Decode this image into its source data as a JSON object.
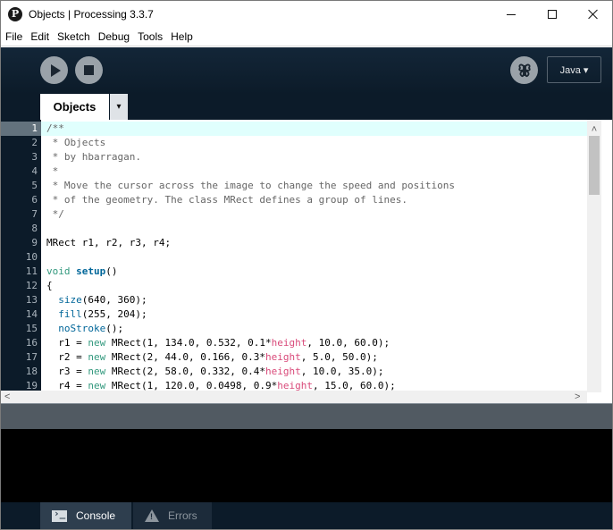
{
  "window": {
    "title": "Objects | Processing 3.3.7",
    "app_icon_letter": "P"
  },
  "menu": [
    "File",
    "Edit",
    "Sketch",
    "Debug",
    "Tools",
    "Help"
  ],
  "toolbar": {
    "run_icon": "play-icon",
    "stop_icon": "stop-icon",
    "debugger_icon": "butterfly-icon",
    "mode_label": "Java ▾"
  },
  "tabs": {
    "active": "Objects",
    "menu_glyph": "▾"
  },
  "editor": {
    "current_line": 1,
    "line_numbers": [
      "1",
      "2",
      "3",
      "4",
      "5",
      "6",
      "7",
      "8",
      "9",
      "10",
      "11",
      "12",
      "13",
      "14",
      "15",
      "16",
      "17",
      "18",
      "19"
    ],
    "lines": [
      [
        {
          "t": "/**",
          "c": "comment"
        }
      ],
      [
        {
          "t": " * Objects",
          "c": "comment"
        }
      ],
      [
        {
          "t": " * by hbarragan.",
          "c": "comment"
        }
      ],
      [
        {
          "t": " *",
          "c": "comment"
        }
      ],
      [
        {
          "t": " * Move the cursor across the image to change the speed and positions",
          "c": "comment"
        }
      ],
      [
        {
          "t": " * of the geometry. The class MRect defines a group of lines.",
          "c": "comment"
        }
      ],
      [
        {
          "t": " */",
          "c": "comment"
        }
      ],
      [],
      [
        {
          "t": "MRect r1, r2, r3, r4;",
          "c": ""
        }
      ],
      [],
      [
        {
          "t": "void",
          "c": "kw"
        },
        {
          "t": " ",
          "c": ""
        },
        {
          "t": "setup",
          "c": "fnb"
        },
        {
          "t": "()",
          "c": ""
        }
      ],
      [
        {
          "t": "{",
          "c": ""
        }
      ],
      [
        {
          "t": "  ",
          "c": ""
        },
        {
          "t": "size",
          "c": "fn"
        },
        {
          "t": "(640, 360);",
          "c": ""
        }
      ],
      [
        {
          "t": "  ",
          "c": ""
        },
        {
          "t": "fill",
          "c": "fn"
        },
        {
          "t": "(255, 204);",
          "c": ""
        }
      ],
      [
        {
          "t": "  ",
          "c": ""
        },
        {
          "t": "noStroke",
          "c": "fn"
        },
        {
          "t": "();",
          "c": ""
        }
      ],
      [
        {
          "t": "  r1 = ",
          "c": ""
        },
        {
          "t": "new",
          "c": "kw"
        },
        {
          "t": " MRect(1, 134.0, 0.532, 0.1*",
          "c": ""
        },
        {
          "t": "height",
          "c": "hl"
        },
        {
          "t": ", 10.0, 60.0);",
          "c": ""
        }
      ],
      [
        {
          "t": "  r2 = ",
          "c": ""
        },
        {
          "t": "new",
          "c": "kw"
        },
        {
          "t": " MRect(2, 44.0, 0.166, 0.3*",
          "c": ""
        },
        {
          "t": "height",
          "c": "hl"
        },
        {
          "t": ", 5.0, 50.0);",
          "c": ""
        }
      ],
      [
        {
          "t": "  r3 = ",
          "c": ""
        },
        {
          "t": "new",
          "c": "kw"
        },
        {
          "t": " MRect(2, 58.0, 0.332, 0.4*",
          "c": ""
        },
        {
          "t": "height",
          "c": "hl"
        },
        {
          "t": ", 10.0, 35.0);",
          "c": ""
        }
      ],
      [
        {
          "t": "  r4 = ",
          "c": ""
        },
        {
          "t": "new",
          "c": "kw"
        },
        {
          "t": " MRect(1, 120.0, 0.0498, 0.9*",
          "c": ""
        },
        {
          "t": "height",
          "c": "hl"
        },
        {
          "t": ", 15.0, 60.0);",
          "c": ""
        }
      ]
    ]
  },
  "scrollbars": {
    "left_arrow": "<",
    "right_arrow": ">",
    "up_arrow": "˄"
  },
  "footer": {
    "console_label": "Console",
    "errors_label": "Errors"
  },
  "colors": {
    "toolbar_bg": "#0c1b29",
    "comment": "#666666",
    "keyword": "#33997e",
    "function": "#006699",
    "builtin_var": "#d94a7a",
    "current_line": "#e0fffd"
  }
}
